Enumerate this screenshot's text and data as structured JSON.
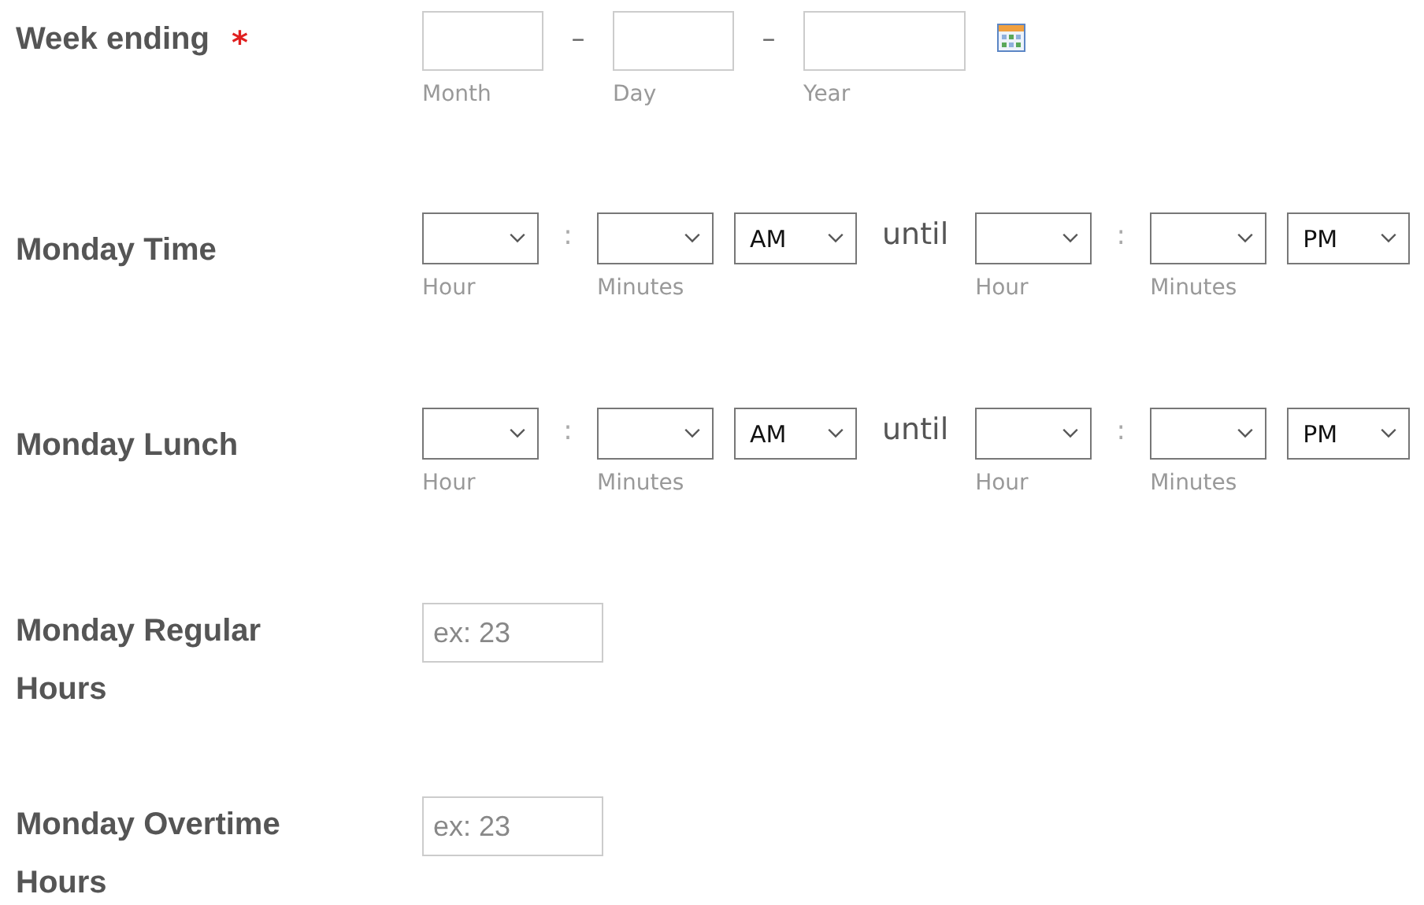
{
  "fields": [
    {
      "kind": "date",
      "label": "Week ending",
      "required_mark": "*",
      "parts": [
        {
          "sublabel": "Month",
          "wide": false
        },
        {
          "separator": "–",
          "sublabel": "Day",
          "wide": false
        },
        {
          "separator": "–",
          "sublabel": "Year",
          "wide": true
        }
      ]
    },
    {
      "kind": "time_range",
      "label": "Monday Time",
      "start": {
        "hour_label": "Hour",
        "minutes_label": "Minutes",
        "separator": ":",
        "period": "AM"
      },
      "joiner": "until",
      "end": {
        "hour_label": "Hour",
        "minutes_label": "Minutes",
        "separator": ":",
        "period": "PM"
      }
    },
    {
      "kind": "time_range",
      "label": "Monday Lunch",
      "start": {
        "hour_label": "Hour",
        "minutes_label": "Minutes",
        "separator": ":",
        "period": "AM"
      },
      "joiner": "until",
      "end": {
        "hour_label": "Hour",
        "minutes_label": "Minutes",
        "separator": ":",
        "period": "PM"
      }
    },
    {
      "kind": "number",
      "label": "Monday Regular Hours",
      "placeholder": "ex: 23"
    },
    {
      "kind": "number",
      "label": "Monday Overtime Hours",
      "placeholder": "ex: 23"
    }
  ]
}
